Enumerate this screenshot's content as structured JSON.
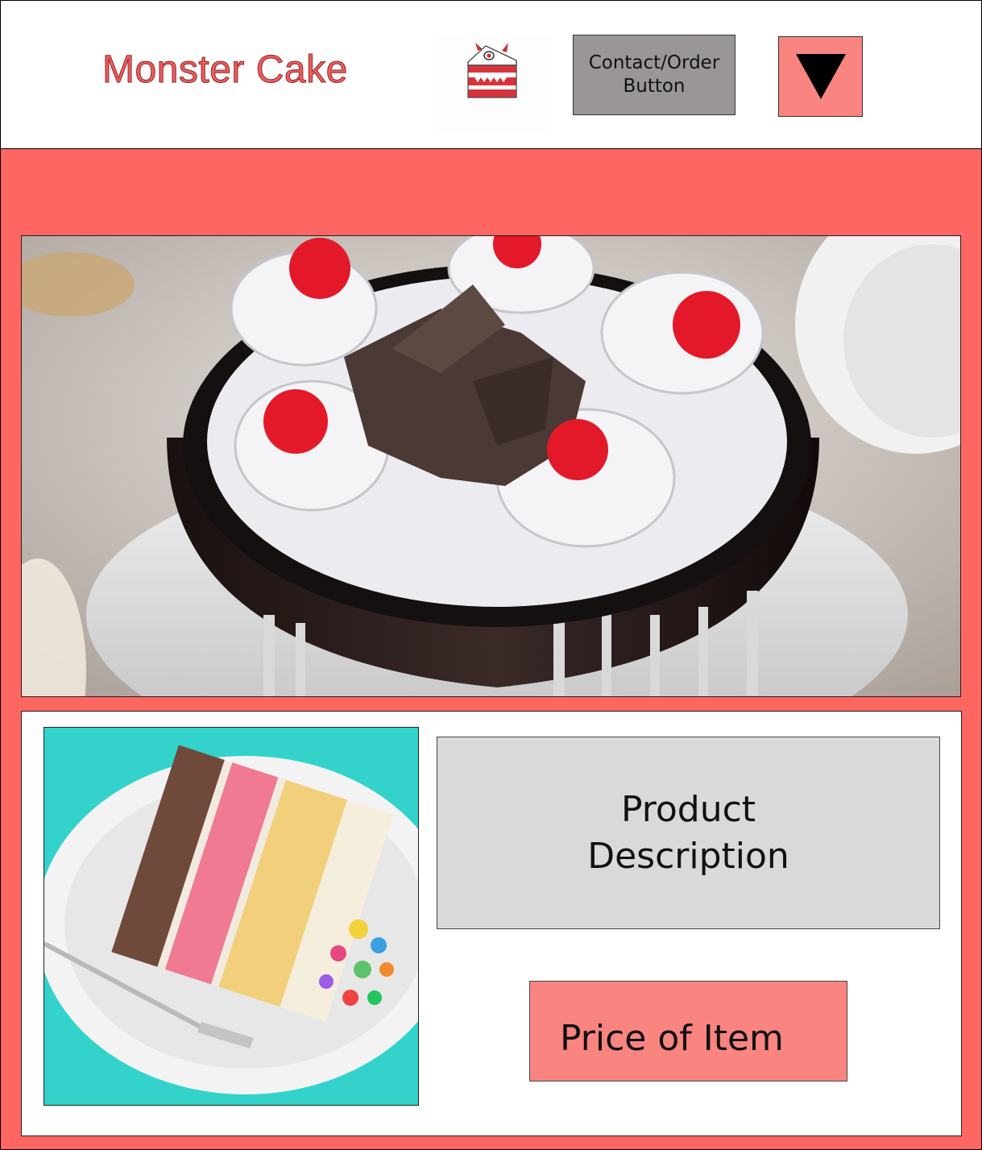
{
  "header": {
    "brand": "Monster Cake",
    "logo_icon": "monster-cake-logo-icon",
    "contact_button_label": "Contact/Order Button",
    "dropdown_icon": "triangle-down-icon"
  },
  "hero": {
    "image": "black-forest-cake-photo"
  },
  "product_card": {
    "image": "layered-cake-slice-photo",
    "description_label": "Product Description",
    "price_label": "Price of Item"
  },
  "colors": {
    "brand_text": "#f05b5b",
    "main_background": "#fe6662",
    "accent_button": "#f98480",
    "contact_button": "#9a9696",
    "description_box": "#d9d9d9"
  }
}
